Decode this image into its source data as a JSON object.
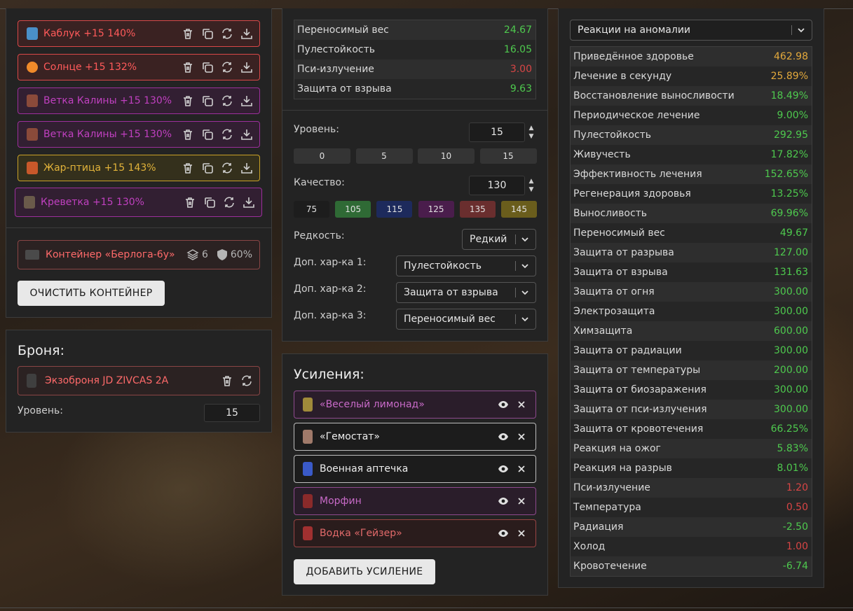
{
  "artifacts": [
    {
      "name": "Каблук +15 140%",
      "color": "#ff5a5a",
      "border": "#d94848",
      "bg": "#3a2222",
      "thumb": "#4a8fc8"
    },
    {
      "name": "Солнце +15 132%",
      "color": "#ff5a5a",
      "border": "#d94848",
      "bg": "#3a2222",
      "thumb": "#f08a2a"
    },
    {
      "name": "Ветка Калины +15 130%",
      "color": "#c040c0",
      "border": "#9c2f9c",
      "bg": "#321f32",
      "thumb": "#8a4a3a"
    },
    {
      "name": "Ветка Калины +15 130%",
      "color": "#c040c0",
      "border": "#9c2f9c",
      "bg": "#321f32",
      "thumb": "#8a4a3a"
    },
    {
      "name": "Жар-птица +15 143%",
      "color": "#e2b33a",
      "border": "#c9a227",
      "bg": "#34301c",
      "thumb": "#c8582a"
    },
    {
      "name": "Креветка +15 130%",
      "color": "#c040c0",
      "border": "#9c2f9c",
      "bg": "#321f32",
      "thumb": "#6a5a4a"
    }
  ],
  "container": {
    "name": "Контейнер «Берлога-6у»",
    "slots": "6",
    "protection": "60%",
    "clear_label": "ОЧИСТИТЬ КОНТЕЙНЕР"
  },
  "armor": {
    "heading": "Броня:",
    "name": "Экзоброня JD ZIVCAS 2A",
    "level_label": "Уровень:",
    "level_value": "15"
  },
  "artifact_stats": [
    {
      "label": "Переносимый вес",
      "value": "24.67",
      "tone": "green"
    },
    {
      "label": "Пулестойкость",
      "value": "16.05",
      "tone": "green"
    },
    {
      "label": "Пси-излучение",
      "value": "3.00",
      "tone": "red"
    },
    {
      "label": "Защита от взрыва",
      "value": "9.63",
      "tone": "green"
    }
  ],
  "editor": {
    "level_label": "Уровень:",
    "level_value": "15",
    "level_presets": [
      "0",
      "5",
      "10",
      "15"
    ],
    "quality_label": "Качество:",
    "quality_value": "130",
    "quality_presets": [
      {
        "value": "75",
        "color": "#1d1d1d"
      },
      {
        "value": "105",
        "color": "#2f6a35"
      },
      {
        "value": "115",
        "color": "#1d2a5c"
      },
      {
        "value": "125",
        "color": "#4a1d4c"
      },
      {
        "value": "135",
        "color": "#6a2e2e"
      },
      {
        "value": "145",
        "color": "#6a5d1c"
      }
    ],
    "rarity_label": "Редкость:",
    "rarity_value": "Редкий",
    "extra1_label": "Доп. хар-ка 1:",
    "extra1_value": "Пулестойкость",
    "extra2_label": "Доп. хар-ка 2:",
    "extra2_value": "Защита от взрыва",
    "extra3_label": "Доп. хар-ка 3:",
    "extra3_value": "Переносимый вес"
  },
  "boosts": {
    "heading": "Усиления:",
    "items": [
      {
        "name": "«Веселый лимонад»",
        "color": "#c86ac8",
        "border": "#8e4a8e",
        "bg": "#2a1d2a",
        "thumb": "#a08a3a"
      },
      {
        "name": "«Гемостат»",
        "color": "#eeeeee",
        "border": "#bdbdbd",
        "bg": "#1c1c1c",
        "thumb": "#a07a6a"
      },
      {
        "name": "Военная аптечка",
        "color": "#eeeeee",
        "border": "#bdbdbd",
        "bg": "#1c1c1c",
        "thumb": "#3a5ac8"
      },
      {
        "name": "Морфин",
        "color": "#c86ac8",
        "border": "#8e4a8e",
        "bg": "#2a1d2a",
        "thumb": "#8a2a2a"
      },
      {
        "name": "Водка «Гейзер»",
        "color": "#e26a6a",
        "border": "#9a4545",
        "bg": "#2a1c1c",
        "thumb": "#a03030"
      }
    ],
    "add_label": "ДОБАВИТЬ УСИЛЕНИЕ"
  },
  "summary": {
    "filter_value": "Реакции на аномалии",
    "rows": [
      {
        "label": "Приведённое здоровье",
        "value": "462.98",
        "tone": "orange"
      },
      {
        "label": "Лечение в секунду",
        "value": "25.89%",
        "tone": "orange"
      },
      {
        "label": "Восстановление выносливости",
        "value": "18.49%",
        "tone": "green"
      },
      {
        "label": "Периодическое лечение",
        "value": "9.00%",
        "tone": "green"
      },
      {
        "label": "Пулестойкость",
        "value": "292.95",
        "tone": "green"
      },
      {
        "label": "Живучесть",
        "value": "17.82%",
        "tone": "green"
      },
      {
        "label": "Эффективность лечения",
        "value": "152.65%",
        "tone": "green"
      },
      {
        "label": "Регенерация здоровья",
        "value": "13.25%",
        "tone": "green"
      },
      {
        "label": "Выносливость",
        "value": "69.96%",
        "tone": "green"
      },
      {
        "label": "Переносимый вес",
        "value": "49.67",
        "tone": "green"
      },
      {
        "label": "Защита от разрыва",
        "value": "127.00",
        "tone": "green"
      },
      {
        "label": "Защита от взрыва",
        "value": "131.63",
        "tone": "green"
      },
      {
        "label": "Защита от огня",
        "value": "300.00",
        "tone": "green"
      },
      {
        "label": "Электрозащита",
        "value": "300.00",
        "tone": "green"
      },
      {
        "label": "Химзащита",
        "value": "600.00",
        "tone": "green"
      },
      {
        "label": "Защита от радиации",
        "value": "300.00",
        "tone": "green"
      },
      {
        "label": "Защита от температуры",
        "value": "200.00",
        "tone": "green"
      },
      {
        "label": "Защита от биозаражения",
        "value": "300.00",
        "tone": "green"
      },
      {
        "label": "Защита от пси-излучения",
        "value": "300.00",
        "tone": "green"
      },
      {
        "label": "Защита от кровотечения",
        "value": "66.25%",
        "tone": "green"
      },
      {
        "label": "Реакция на ожог",
        "value": "5.83%",
        "tone": "green"
      },
      {
        "label": "Реакция на разрыв",
        "value": "8.01%",
        "tone": "green"
      },
      {
        "label": "Пси-излучение",
        "value": "1.20",
        "tone": "red"
      },
      {
        "label": "Температура",
        "value": "0.50",
        "tone": "red"
      },
      {
        "label": "Радиация",
        "value": "-2.50",
        "tone": "green"
      },
      {
        "label": "Холод",
        "value": "1.00",
        "tone": "red"
      },
      {
        "label": "Кровотечение",
        "value": "-6.74",
        "tone": "green"
      }
    ]
  }
}
